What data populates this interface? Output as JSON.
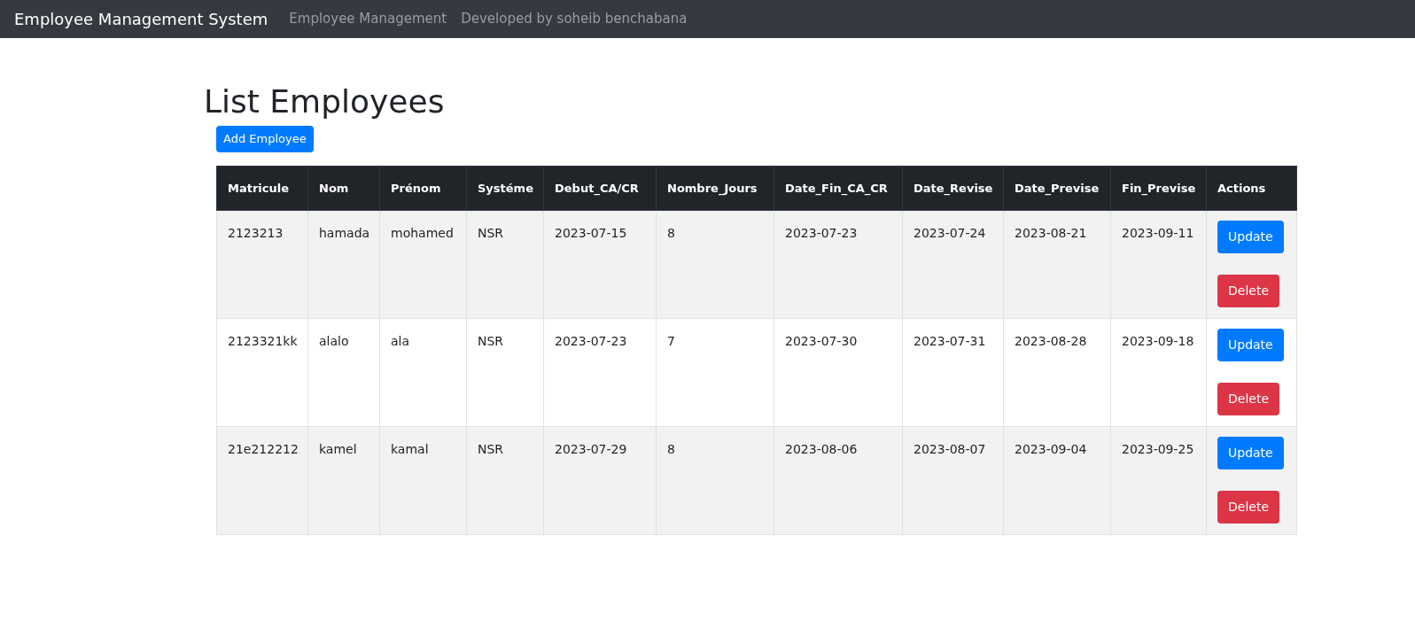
{
  "navbar": {
    "brand": "Employee Management System",
    "links": [
      "Employee Management",
      "Developed by soheib benchabana"
    ]
  },
  "title": "List Employees",
  "add_button": "Add Employee",
  "table": {
    "columns": [
      "Matricule",
      "Nom",
      "Prénom",
      "Systéme",
      "Debut_CA/CR",
      "Nombre_Jours",
      "Date_Fin_CA_CR",
      "Date_Revise",
      "Date_Previse",
      "Fin_Previse",
      "Actions"
    ],
    "rows": [
      {
        "cells": [
          "2123213",
          "hamada",
          "mohamed",
          "NSR",
          "2023-07-15",
          "8",
          "2023-07-23",
          "2023-07-24",
          "2023-08-21",
          "2023-09-11"
        ],
        "actions": [
          {
            "kind": "update",
            "label": "Update"
          },
          {
            "kind": "delete",
            "label": "Delete"
          }
        ]
      },
      {
        "cells": [
          "2123321kk",
          "alalo",
          "ala",
          "NSR",
          "2023-07-23",
          "7",
          "2023-07-30",
          "2023-07-31",
          "2023-08-28",
          "2023-09-18"
        ],
        "actions": [
          {
            "kind": "update",
            "label": "Update"
          },
          {
            "kind": "delete",
            "label": "Delete"
          }
        ]
      },
      {
        "cells": [
          "21e212212",
          "kamel",
          "kamal",
          "NSR",
          "2023-07-29",
          "8",
          "2023-08-06",
          "2023-08-07",
          "2023-09-04",
          "2023-09-25"
        ],
        "actions": [
          {
            "kind": "update",
            "label": "Update"
          },
          {
            "kind": "delete",
            "label": "Delete"
          }
        ]
      }
    ]
  }
}
